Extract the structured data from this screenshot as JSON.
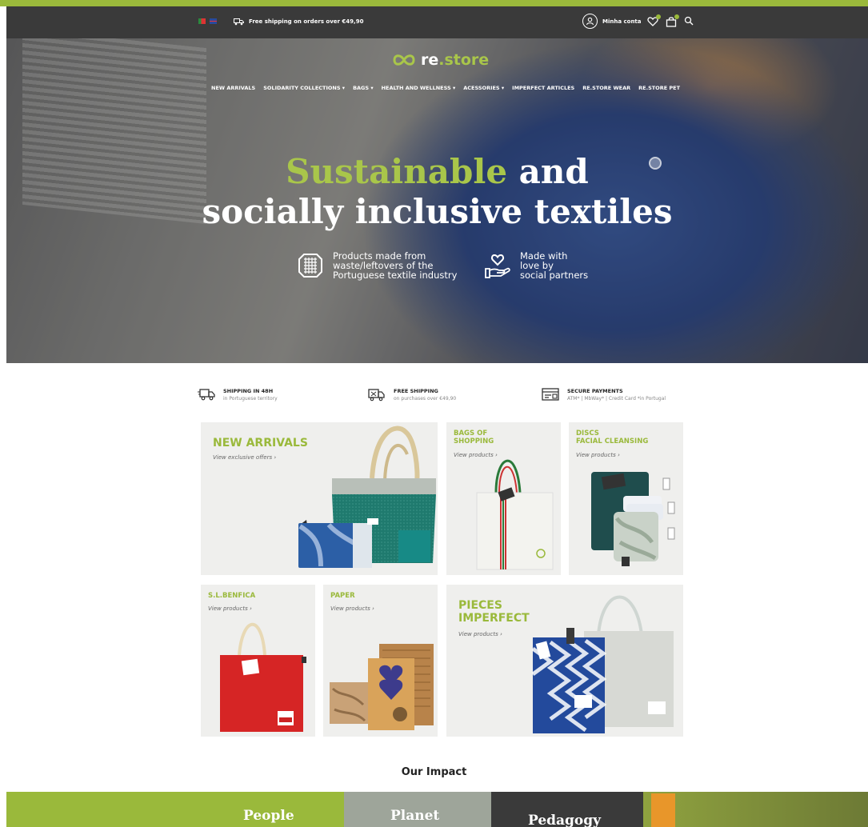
{
  "topbar": {
    "shipping_note": "Free shipping on orders over €49,90",
    "account_label": "Minha conta"
  },
  "brand": {
    "name_prefix": "re",
    "name_suffix": ".store"
  },
  "nav": {
    "items": [
      {
        "label": "NEW ARRIVALS",
        "dropdown": false
      },
      {
        "label": "SOLIDARITY COLLECTIONS",
        "dropdown": true
      },
      {
        "label": "BAGS",
        "dropdown": true
      },
      {
        "label": "HEALTH AND WELLNESS",
        "dropdown": true
      },
      {
        "label": "ACESSORIES",
        "dropdown": true
      },
      {
        "label": "IMPERFECT ARTICLES",
        "dropdown": false
      },
      {
        "label": "RE.STORE WEAR",
        "dropdown": false
      },
      {
        "label": "RE.STORE PET",
        "dropdown": false
      }
    ]
  },
  "hero": {
    "headline_accent": "Sustainable",
    "headline_rest_1": " and",
    "headline_line_2": "socially inclusive textiles",
    "feature_1": "Products made from\nwaste/leftovers of the\nPortuguese textile industry",
    "feature_2": "Made with\nlove by\nsocial partners"
  },
  "benefits": [
    {
      "title": "SHIPPING IN 48H",
      "subtitle": "in Portuguese territory",
      "icon": "truck-icon"
    },
    {
      "title": "FREE SHIPPING",
      "subtitle": "on purchases over €49,90",
      "icon": "free-shipping-icon"
    },
    {
      "title": "SECURE PAYMENTS",
      "subtitle": "ATM* | MbWay* | Credit Card *in Portugal",
      "icon": "payment-icon"
    }
  ],
  "tiles": {
    "new_arrivals": {
      "title": "NEW ARRIVALS",
      "link": "View exclusive offers"
    },
    "bags": {
      "title": "BAGS OF\nSHOPPING",
      "link": "View products"
    },
    "discs": {
      "title": "DISCS\nFACIAL CLEANSING",
      "link": "View products"
    },
    "benfica": {
      "title": "S.L.BENFICA",
      "link": "View products"
    },
    "paper": {
      "title": "PAPER",
      "link": "View products"
    },
    "imperfect": {
      "title": "PIECES\nIMPERFECT",
      "link": "View products"
    }
  },
  "impact": {
    "title": "Our Impact",
    "tabs": [
      "People",
      "Planet",
      "Pedagogy"
    ]
  },
  "colors": {
    "accent": "#9ab93b",
    "topbar": "#3a3a3a",
    "tile_bg": "#efefed"
  }
}
